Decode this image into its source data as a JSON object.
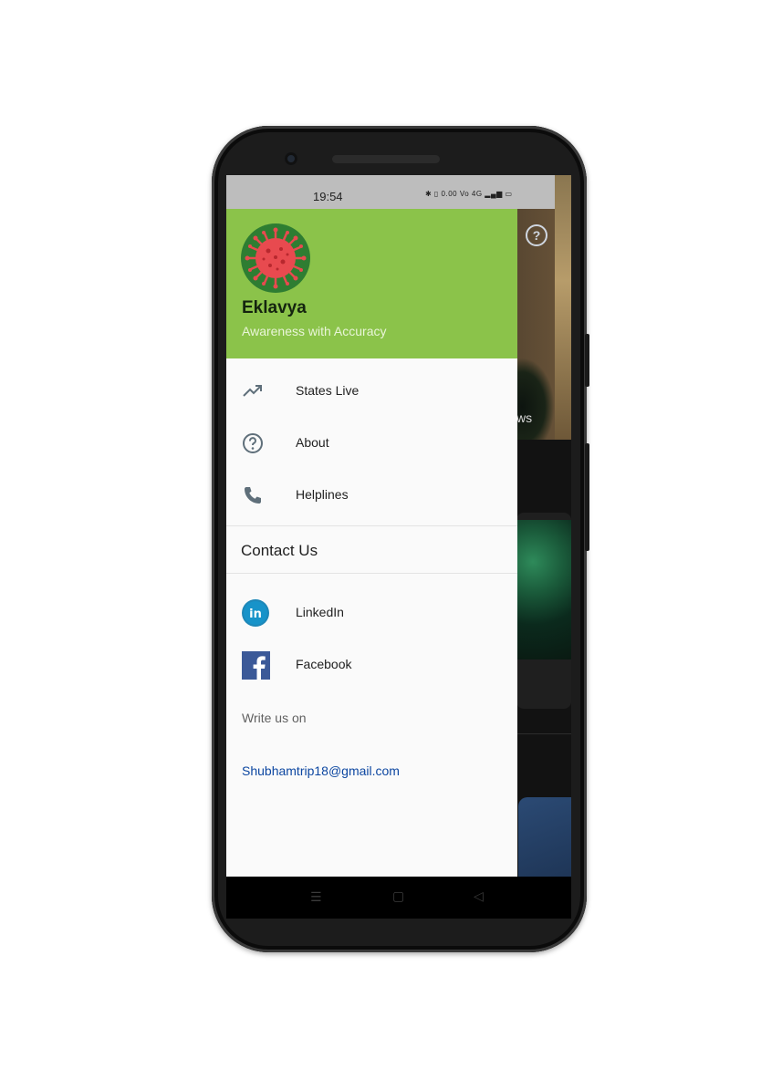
{
  "status_bar": {
    "time": "19:54",
    "icons": "✱ ▯ 0.00 Vo 4G ▂▄▆ ▭"
  },
  "drawer": {
    "app_name": "Eklavya",
    "tagline": "Awareness with Accuracy",
    "menu": [
      {
        "label": "States Live",
        "icon": "trending-up-icon"
      },
      {
        "label": "About",
        "icon": "help-circle-icon"
      },
      {
        "label": "Helplines",
        "icon": "phone-icon"
      }
    ],
    "contact_title": "Contact Us",
    "social": [
      {
        "label": "LinkedIn",
        "icon": "linkedin-icon"
      },
      {
        "label": "Facebook",
        "icon": "facebook-icon"
      }
    ],
    "write_us": "Write us on",
    "email": "Shubhamtrip18@gmail.com"
  },
  "background_app": {
    "news_fragment": "ws"
  },
  "colors": {
    "header_green": "#8bc34a",
    "logo_green": "#2e7d32",
    "virus_red": "#e84a4f",
    "email_blue": "#0d47a1"
  }
}
